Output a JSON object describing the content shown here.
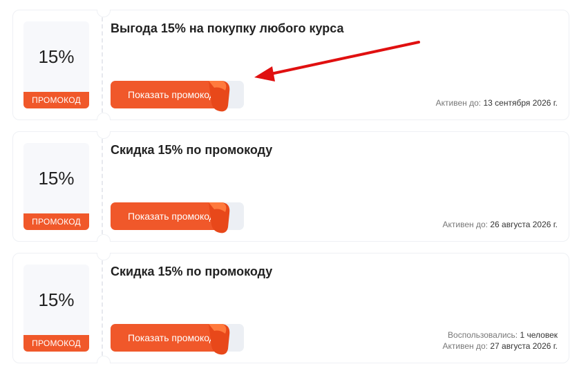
{
  "coupons": [
    {
      "discount": "15%",
      "tag": "ПРОМОКОД",
      "title": "Выгода 15% на покупку любого курса",
      "button": "Показать промокод",
      "used_label": "",
      "used_value": "",
      "active_label": "Активен до:",
      "active_value": "13 сентября 2026 г."
    },
    {
      "discount": "15%",
      "tag": "ПРОМОКОД",
      "title": "Скидка 15% по промокоду",
      "button": "Показать промокод",
      "used_label": "",
      "used_value": "",
      "active_label": "Активен до:",
      "active_value": "26 августа 2026 г."
    },
    {
      "discount": "15%",
      "tag": "ПРОМОКОД",
      "title": "Скидка 15% по промокоду",
      "button": "Показать промокод",
      "used_label": "Воспользовались:",
      "used_value": "1 человек",
      "active_label": "Активен до:",
      "active_value": "27 августа 2026 г."
    }
  ],
  "colors": {
    "accent": "#f0582a",
    "annotation_arrow": "#e01010"
  }
}
